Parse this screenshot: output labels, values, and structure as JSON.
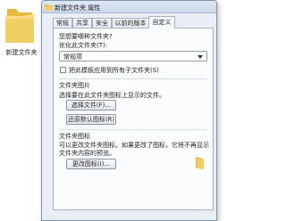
{
  "desktop": {
    "folder_label": "新建文件夹"
  },
  "dialog": {
    "title": "新建文件夹 属性",
    "tabs": [
      {
        "label": "常规"
      },
      {
        "label": "共享"
      },
      {
        "label": "安全"
      },
      {
        "label": "以前的版本"
      },
      {
        "label": "自定义"
      }
    ],
    "active_tab": "自定义",
    "optimize": {
      "heading": "您想要哪种文件夹?",
      "label": "优化此文件夹(T):",
      "selected": "常规项",
      "apply_all_label": "把此模板应用到所有子文件夹(S)",
      "apply_all_checked": false
    },
    "pictures": {
      "heading": "文件夹图片",
      "description": "选择要在此文件夹图标上显示的文件。",
      "choose_button": "选择文件(F)...",
      "restore_button": "还原默认图标(R)"
    },
    "icons": {
      "heading": "文件夹图标",
      "description_line1": "可以更改文件夹图标。如果更改了图标，它将不再显示",
      "description_line2": "文件夹内容的预览。",
      "change_button": "更改图标(I)..."
    }
  },
  "icons": {
    "folder": "folder-icon",
    "title_folder": "folder-small-icon"
  },
  "colors": {
    "folder_fill": "#f2cf63",
    "folder_back": "#e8bb3f"
  }
}
